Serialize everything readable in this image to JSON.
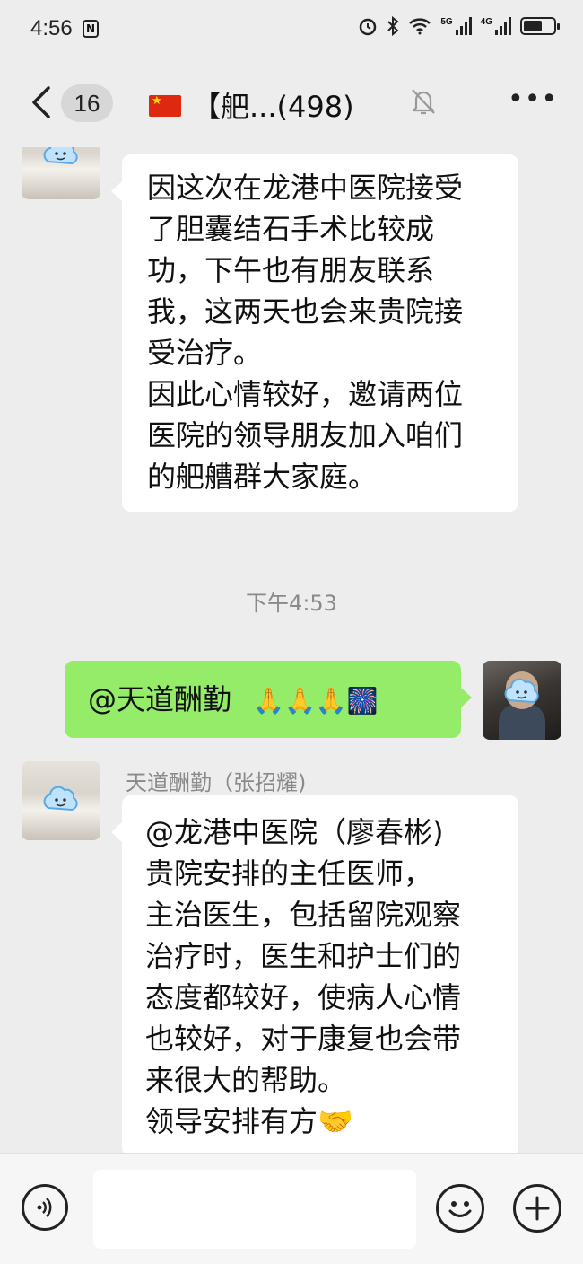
{
  "status_bar": {
    "time": "4:56",
    "nfc_label": "N",
    "signal_1_label": "5G",
    "signal_2_label": "4G"
  },
  "header": {
    "unread_count": "16",
    "title": "【舥...(498)"
  },
  "messages": [
    {
      "side": "left",
      "lines": [
        "因这次在龙港中医院接受",
        "了胆囊结石手术比较成",
        "功，下午也有朋友联系",
        "我，这两天也会来贵院接",
        "受治疗。",
        "因此心情较好，邀请两位",
        "医院的领导朋友加入咱们",
        "的舥艚群大家庭。"
      ]
    },
    {
      "side": "time",
      "text": "下午4:53"
    },
    {
      "side": "right",
      "text": "@天道酬勤",
      "emojis": "🙏🙏🙏🎆"
    },
    {
      "side": "left",
      "sender": "天道酬勤（张招耀)",
      "lines": [
        "@龙港中医院（廖春彬)",
        " 贵院安排的主任医师，",
        "主治医生，包括留院观察",
        "治疗时，医生和护士们的",
        "态度都较好，使病人心情",
        "也较好，对于康复也会带",
        "来很大的帮助。",
        "领导安排有方🤝"
      ]
    }
  ],
  "input": {
    "placeholder": ""
  },
  "colors": {
    "background": "#ededed",
    "bubble_self": "#95ec69",
    "bubble_other": "#ffffff"
  }
}
